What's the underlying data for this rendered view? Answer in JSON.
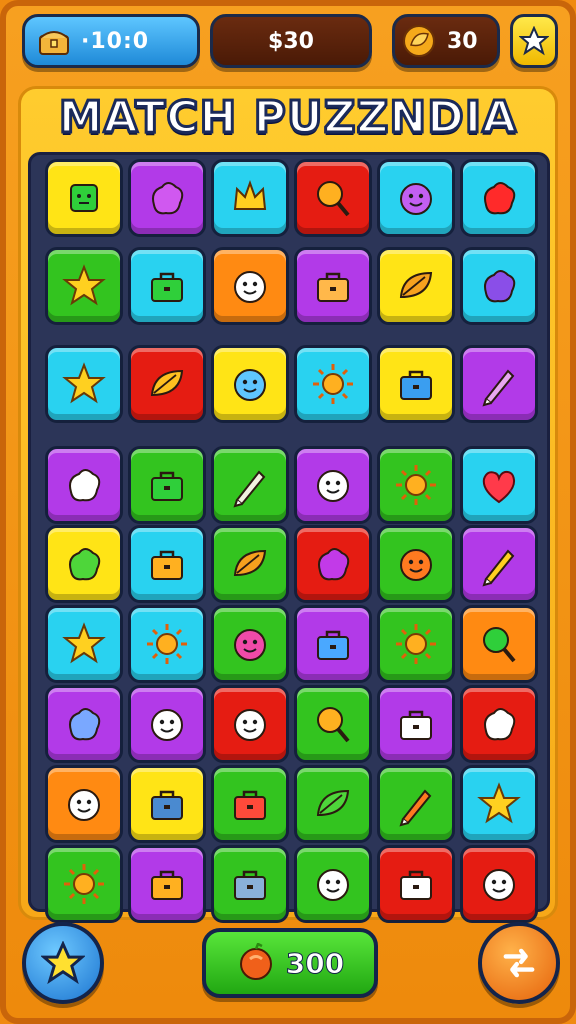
{
  "hud": {
    "timer": "·10:0",
    "score": "$30",
    "coins": "30",
    "timer_icon": "treasure-chest-icon",
    "coin_icon": "leaf-coin-icon",
    "star_icon": "star-icon"
  },
  "title": "MATCH PUZZNDIA",
  "board": {
    "rows": [
      [
        {
          "color": "yellow",
          "icon": "green-cube-icon"
        },
        {
          "color": "purple",
          "icon": "swirl-icon"
        },
        {
          "color": "cyan",
          "icon": "crown-icon"
        },
        {
          "color": "red",
          "icon": "magnifier-icon"
        },
        {
          "color": "cyan",
          "icon": "monster-face-icon"
        },
        {
          "color": "cyan",
          "icon": "jellybean-icon"
        }
      ],
      [
        {
          "color": "green",
          "icon": "star-face-icon"
        },
        {
          "color": "cyan",
          "icon": "briefcase-icon"
        },
        {
          "color": "orange",
          "icon": "pen-icon"
        },
        {
          "color": "purple",
          "icon": "scroll-icon"
        },
        {
          "color": "yellow",
          "icon": "croissant-icon"
        },
        {
          "color": "cyan",
          "icon": "spiral-shell-icon"
        }
      ],
      [
        {
          "color": "cyan",
          "icon": "starfish-icon"
        },
        {
          "color": "red",
          "icon": "deer-icon"
        },
        {
          "color": "yellow",
          "icon": "blue-monster-icon"
        },
        {
          "color": "cyan",
          "icon": "sun-face-icon"
        },
        {
          "color": "yellow",
          "icon": "potted-plant-icon"
        },
        {
          "color": "purple",
          "icon": "mouse-toy-icon"
        }
      ],
      [
        {
          "color": "purple",
          "icon": "cloud-icon"
        },
        {
          "color": "green",
          "icon": "bag-icon"
        },
        {
          "color": "green",
          "icon": "bottle-icon"
        },
        {
          "color": "purple",
          "icon": "cat-face-icon"
        },
        {
          "color": "green",
          "icon": "sun-icon"
        },
        {
          "color": "cyan",
          "icon": "heart-icon"
        }
      ],
      [
        {
          "color": "yellow",
          "icon": "speech-bubble-icon"
        },
        {
          "color": "cyan",
          "icon": "suitcase-icon"
        },
        {
          "color": "green",
          "icon": "croissant-icon"
        },
        {
          "color": "red",
          "icon": "blob-icon"
        },
        {
          "color": "green",
          "icon": "pumpkin-face-icon"
        },
        {
          "color": "purple",
          "icon": "sparkle-tools-icon"
        }
      ],
      [
        {
          "color": "cyan",
          "icon": "green-star-icon"
        },
        {
          "color": "cyan",
          "icon": "sun-icon"
        },
        {
          "color": "green",
          "icon": "pink-monster-icon"
        },
        {
          "color": "purple",
          "icon": "camera-icon"
        },
        {
          "color": "green",
          "icon": "sun-icon"
        },
        {
          "color": "orange",
          "icon": "lollipop-icon"
        }
      ],
      [
        {
          "color": "purple",
          "icon": "bean-icon"
        },
        {
          "color": "purple",
          "icon": "ghost-face-icon"
        },
        {
          "color": "red",
          "icon": "pen-icon"
        },
        {
          "color": "green",
          "icon": "smiley-pin-icon"
        },
        {
          "color": "purple",
          "icon": "card-icon"
        },
        {
          "color": "red",
          "icon": "pig-icon"
        }
      ],
      [
        {
          "color": "orange",
          "icon": "star-icon"
        },
        {
          "color": "yellow",
          "icon": "battery-icon"
        },
        {
          "color": "green",
          "icon": "dice-icon"
        },
        {
          "color": "green",
          "icon": "leaf-icon"
        },
        {
          "color": "green",
          "icon": "hammer-icon"
        },
        {
          "color": "cyan",
          "icon": "flower-icon"
        }
      ],
      [
        {
          "color": "green",
          "icon": "sun-icon"
        },
        {
          "color": "purple",
          "icon": "suitcase-icon"
        },
        {
          "color": "green",
          "icon": "robot-icon"
        },
        {
          "color": "green",
          "icon": "cat-face-icon"
        },
        {
          "color": "red",
          "icon": "radio-icon"
        },
        {
          "color": "red",
          "icon": "smiley-icon"
        }
      ]
    ]
  },
  "bonus": {
    "value": "300",
    "icon": "fruit-coin-icon"
  },
  "buttons": {
    "hint_icon": "star-icon",
    "shuffle_icon": "shuffle-arrow-icon"
  },
  "colors": {
    "yellow": "#ffe416",
    "purple": "#b23ae8",
    "cyan": "#29d2f0",
    "red": "#e51c12",
    "green": "#33c41f",
    "orange": "#ff8a12"
  }
}
